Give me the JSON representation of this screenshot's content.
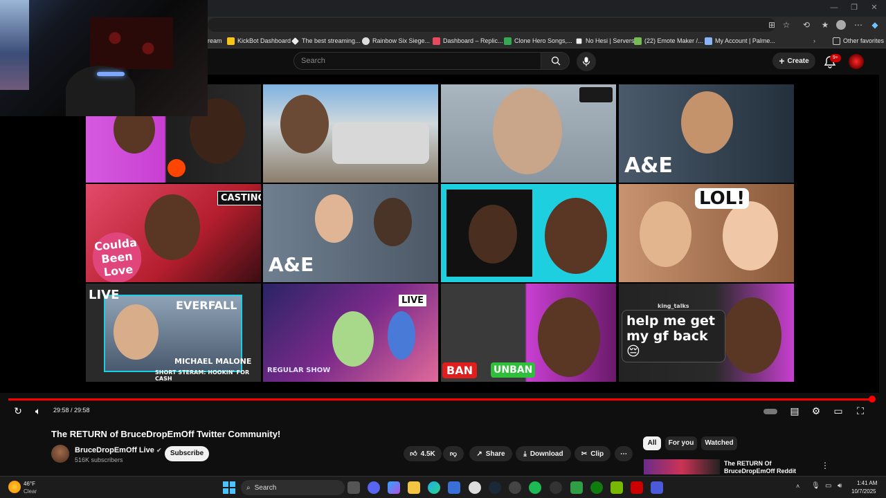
{
  "browser": {
    "bookmarks": [
      {
        "label": "ream",
        "color": "#555555"
      },
      {
        "label": "KickBot Dashboard",
        "color": "#f5c518"
      },
      {
        "label": "The best streaming...",
        "color": "#eeeeee"
      },
      {
        "label": "Rainbow Six Siege...",
        "color": "#eeeeee"
      },
      {
        "label": "Dashboard – Replic...",
        "color": "#e84a5f"
      },
      {
        "label": "Clone Hero Songs,...",
        "color": "#34a853"
      },
      {
        "label": "No Hesi | Servers",
        "color": "#eeeeee"
      },
      {
        "label": "(22) Emote Maker /...",
        "color": "#77bb55"
      },
      {
        "label": "My Account | Palme...",
        "color": "#8ab4f8"
      }
    ],
    "other_favorites": "Other favorites"
  },
  "masthead": {
    "search_placeholder": "Search",
    "create_label": "Create",
    "notification_count": "9+"
  },
  "video": {
    "tiles": [
      {
        "label": "",
        "bg": "#c83fd1"
      },
      {
        "label": "",
        "bg": "#6f8fa8"
      },
      {
        "label": "",
        "bg": "#8c9aa6"
      },
      {
        "label": "A&E",
        "bg": "#3b4a5a"
      },
      {
        "label": "CASTING",
        "bg": "#b31d2c"
      },
      {
        "label": "A&E",
        "bg": "#5a6878"
      },
      {
        "label": "",
        "bg": "#1ecfe0"
      },
      {
        "label": "LOL!",
        "bg": "#b77a55"
      },
      {
        "label": "LIVE",
        "bg": "#2a2a2a"
      },
      {
        "label": "LIVE",
        "bg": "#2a2466"
      },
      {
        "label": "BAN",
        "bg": "#3a3a3a"
      },
      {
        "label": "help me get my gf back 😔",
        "bg": "#232323"
      }
    ],
    "tile_extra": {
      "everfall": "EVERFALL",
      "michael": "MICHAEL MALONE",
      "short_stream": "SHORT STERAM: HOOKIN' FOR CASH",
      "unban": "UNBAN",
      "king_talks": "king_talks",
      "regular_show": "REGULAR SHOW"
    },
    "time": "29:58 / 29:58",
    "progress": 1.0
  },
  "details": {
    "title": "The RETURN of BruceDropEmOff Twitter Community!",
    "channel": "BruceDropEmOff Live",
    "verified_icon": "✔",
    "subscribers": "516K subscribers",
    "subscribe": "Subscribe",
    "likes": "4.5K",
    "share": "Share",
    "download": "Download",
    "clip": "Clip"
  },
  "sidebar": {
    "chips": [
      "All",
      "For you",
      "Watched"
    ],
    "rec_title": "The RETURN Of BruceDropEmOff Reddit"
  },
  "taskbar": {
    "weather_temp": "46°F",
    "weather_cond": "Clear",
    "search": "Search",
    "time": "1:41 AM",
    "date": "10/7/2025"
  }
}
